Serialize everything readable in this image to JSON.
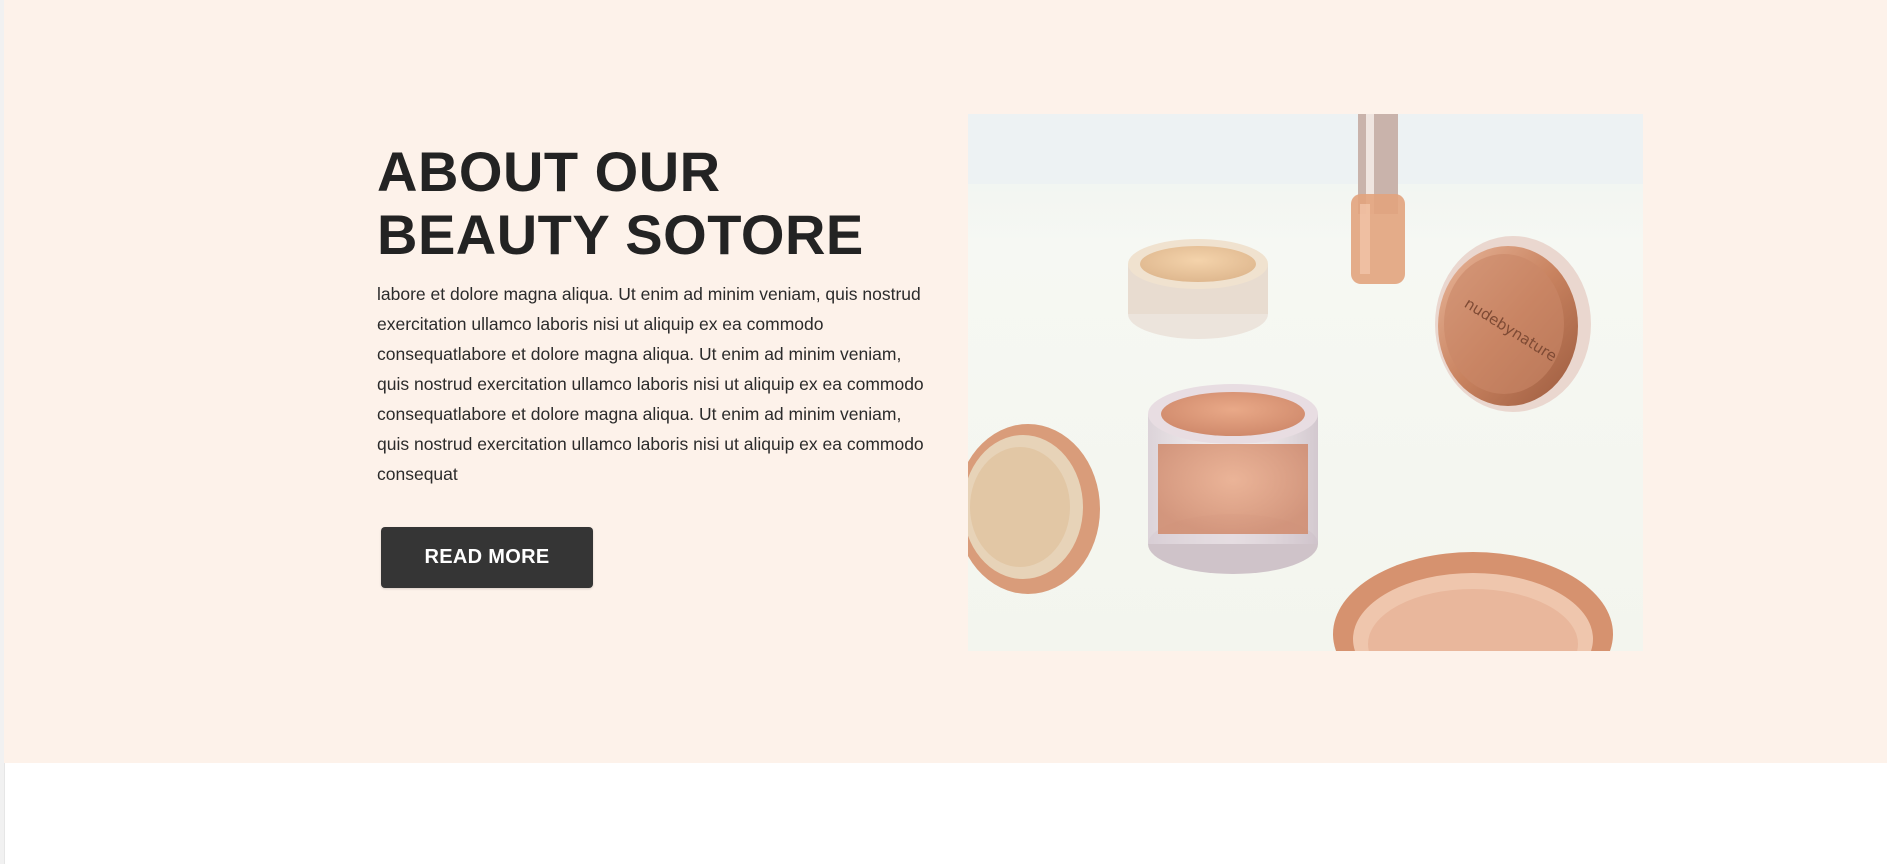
{
  "about": {
    "title_line1": "ABOUT OUR",
    "title_line2": "BEAUTY SOTORE",
    "body": "labore et dolore magna aliqua. Ut enim ad minim veniam, quis nostrud exercitation ullamco laboris nisi ut aliquip ex ea commodo consequatlabore et dolore magna aliqua. Ut enim ad minim veniam, quis nostrud exercitation ullamco laboris nisi ut aliquip ex ea commodo consequatlabore et dolore magna aliqua. Ut enim ad minim veniam, quis nostrud exercitation ullamco laboris nisi ut aliquip ex ea commodo consequat",
    "button_label": "READ MORE",
    "image_label": "nudebynature"
  },
  "colors": {
    "section_bg": "#fdf2ea",
    "title": "#232323",
    "button_bg": "#353535",
    "button_text": "#ffffff"
  }
}
